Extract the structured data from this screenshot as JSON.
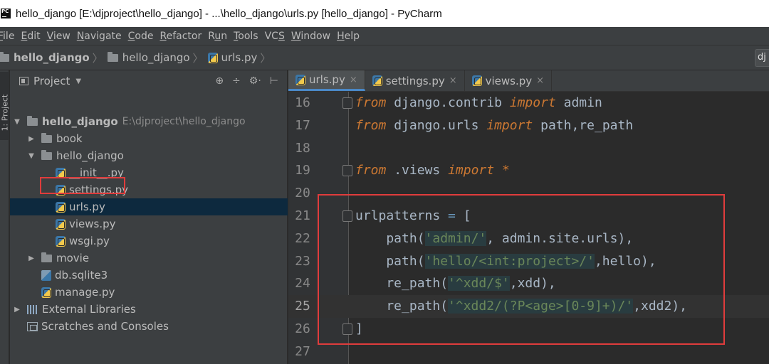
{
  "window": {
    "app_icon": "PC",
    "title": "hello_django [E:\\djproject\\hello_django] - ...\\hello_django\\urls.py [hello_django] - PyCharm"
  },
  "menu": [
    {
      "mnemonic": "F",
      "rest": "ile"
    },
    {
      "mnemonic": "E",
      "rest": "dit"
    },
    {
      "mnemonic": "V",
      "rest": "iew"
    },
    {
      "mnemonic": "N",
      "rest": "avigate"
    },
    {
      "mnemonic": "C",
      "rest": "ode"
    },
    {
      "mnemonic": "R",
      "rest": "efactor"
    },
    {
      "pre": "R",
      "mnemonic": "u",
      "rest": "n"
    },
    {
      "mnemonic": "T",
      "rest": "ools"
    },
    {
      "pre": "VC",
      "mnemonic": "S",
      "rest": ""
    },
    {
      "mnemonic": "W",
      "rest": "indow"
    },
    {
      "mnemonic": "H",
      "rest": "elp"
    }
  ],
  "breadcrumb": [
    "hello_django",
    "hello_django",
    "urls.py"
  ],
  "nav_right_label": "dj",
  "toolstrip": {
    "tab_label": "1: Project"
  },
  "project_panel": {
    "title": "Project",
    "tools": [
      "⊕",
      "÷",
      "⚙·",
      "⊢"
    ],
    "tree": [
      {
        "label": "hello_django",
        "path": "E:\\djproject\\hello_django",
        "kind": "folder",
        "expanded": true,
        "depth": 0
      },
      {
        "label": "book",
        "kind": "folder",
        "expanded": false,
        "depth": 1
      },
      {
        "label": "hello_django",
        "kind": "folder",
        "expanded": true,
        "depth": 1
      },
      {
        "label": "__init__.py",
        "kind": "py",
        "depth": 2
      },
      {
        "label": "settings.py",
        "kind": "py",
        "depth": 2
      },
      {
        "label": "urls.py",
        "kind": "py",
        "depth": 2,
        "selected": true
      },
      {
        "label": "views.py",
        "kind": "py",
        "depth": 2
      },
      {
        "label": "wsgi.py",
        "kind": "py",
        "depth": 2
      },
      {
        "label": "movie",
        "kind": "folder",
        "expanded": false,
        "depth": 1
      },
      {
        "label": "db.sqlite3",
        "kind": "db",
        "depth": 1
      },
      {
        "label": "manage.py",
        "kind": "py",
        "depth": 1
      },
      {
        "label": "External Libraries",
        "kind": "lib",
        "expanded": false,
        "depth": 0
      },
      {
        "label": "Scratches and Consoles",
        "kind": "scratch",
        "depth": 0
      }
    ]
  },
  "editor_tabs": [
    {
      "label": "urls.py",
      "active": true
    },
    {
      "label": "settings.py",
      "active": false
    },
    {
      "label": "views.py",
      "active": false
    }
  ],
  "code_lines": [
    {
      "n": "16",
      "fold": true,
      "tokens": [
        {
          "t": "from",
          "c": "kw"
        },
        {
          "t": " django.contrib ",
          "c": ""
        },
        {
          "t": "import",
          "c": "kw"
        },
        {
          "t": " admin",
          "c": ""
        }
      ]
    },
    {
      "n": "17",
      "tokens": [
        {
          "t": "from",
          "c": "kw"
        },
        {
          "t": " django.urls ",
          "c": ""
        },
        {
          "t": "import",
          "c": "kw"
        },
        {
          "t": " path,re_path",
          "c": ""
        }
      ]
    },
    {
      "n": "18",
      "tokens": []
    },
    {
      "n": "19",
      "fold": true,
      "tokens": [
        {
          "t": "from",
          "c": "kw"
        },
        {
          "t": " .views ",
          "c": ""
        },
        {
          "t": "import",
          "c": "kw"
        },
        {
          "t": " ",
          "c": ""
        },
        {
          "t": "*",
          "c": "star"
        }
      ]
    },
    {
      "n": "20",
      "tokens": []
    },
    {
      "n": "21",
      "fold": true,
      "tokens": [
        {
          "t": "urlpatterns ",
          "c": ""
        },
        {
          "t": "=",
          "c": "blue"
        },
        {
          "t": " [",
          "c": ""
        }
      ]
    },
    {
      "n": "22",
      "tokens": [
        {
          "t": "    path(",
          "c": ""
        },
        {
          "t": "'admin/'",
          "c": "str"
        },
        {
          "t": ", admin.site.urls),",
          "c": ""
        }
      ]
    },
    {
      "n": "23",
      "tokens": [
        {
          "t": "    path(",
          "c": ""
        },
        {
          "t": "'hello/<int:project>/'",
          "c": "str"
        },
        {
          "t": ",hello),",
          "c": ""
        }
      ]
    },
    {
      "n": "24",
      "tokens": [
        {
          "t": "    re_path(",
          "c": ""
        },
        {
          "t": "'^xdd/$'",
          "c": "str"
        },
        {
          "t": ",xdd),",
          "c": ""
        }
      ]
    },
    {
      "n": "25",
      "current": true,
      "tokens": [
        {
          "t": "    re_path(",
          "c": ""
        },
        {
          "t": "'^xdd2/(?P<age>[0-9]+)/'",
          "c": "str"
        },
        {
          "t": ",xdd2),",
          "c": ""
        }
      ]
    },
    {
      "n": "26",
      "fold": true,
      "tokens": [
        {
          "t": "]",
          "c": ""
        }
      ]
    },
    {
      "n": "27",
      "tokens": []
    }
  ],
  "colors": {
    "highlight_box": "#e03c3c",
    "keyword": "#cc7832",
    "string": "#6a8759",
    "selection": "#0d293e"
  }
}
